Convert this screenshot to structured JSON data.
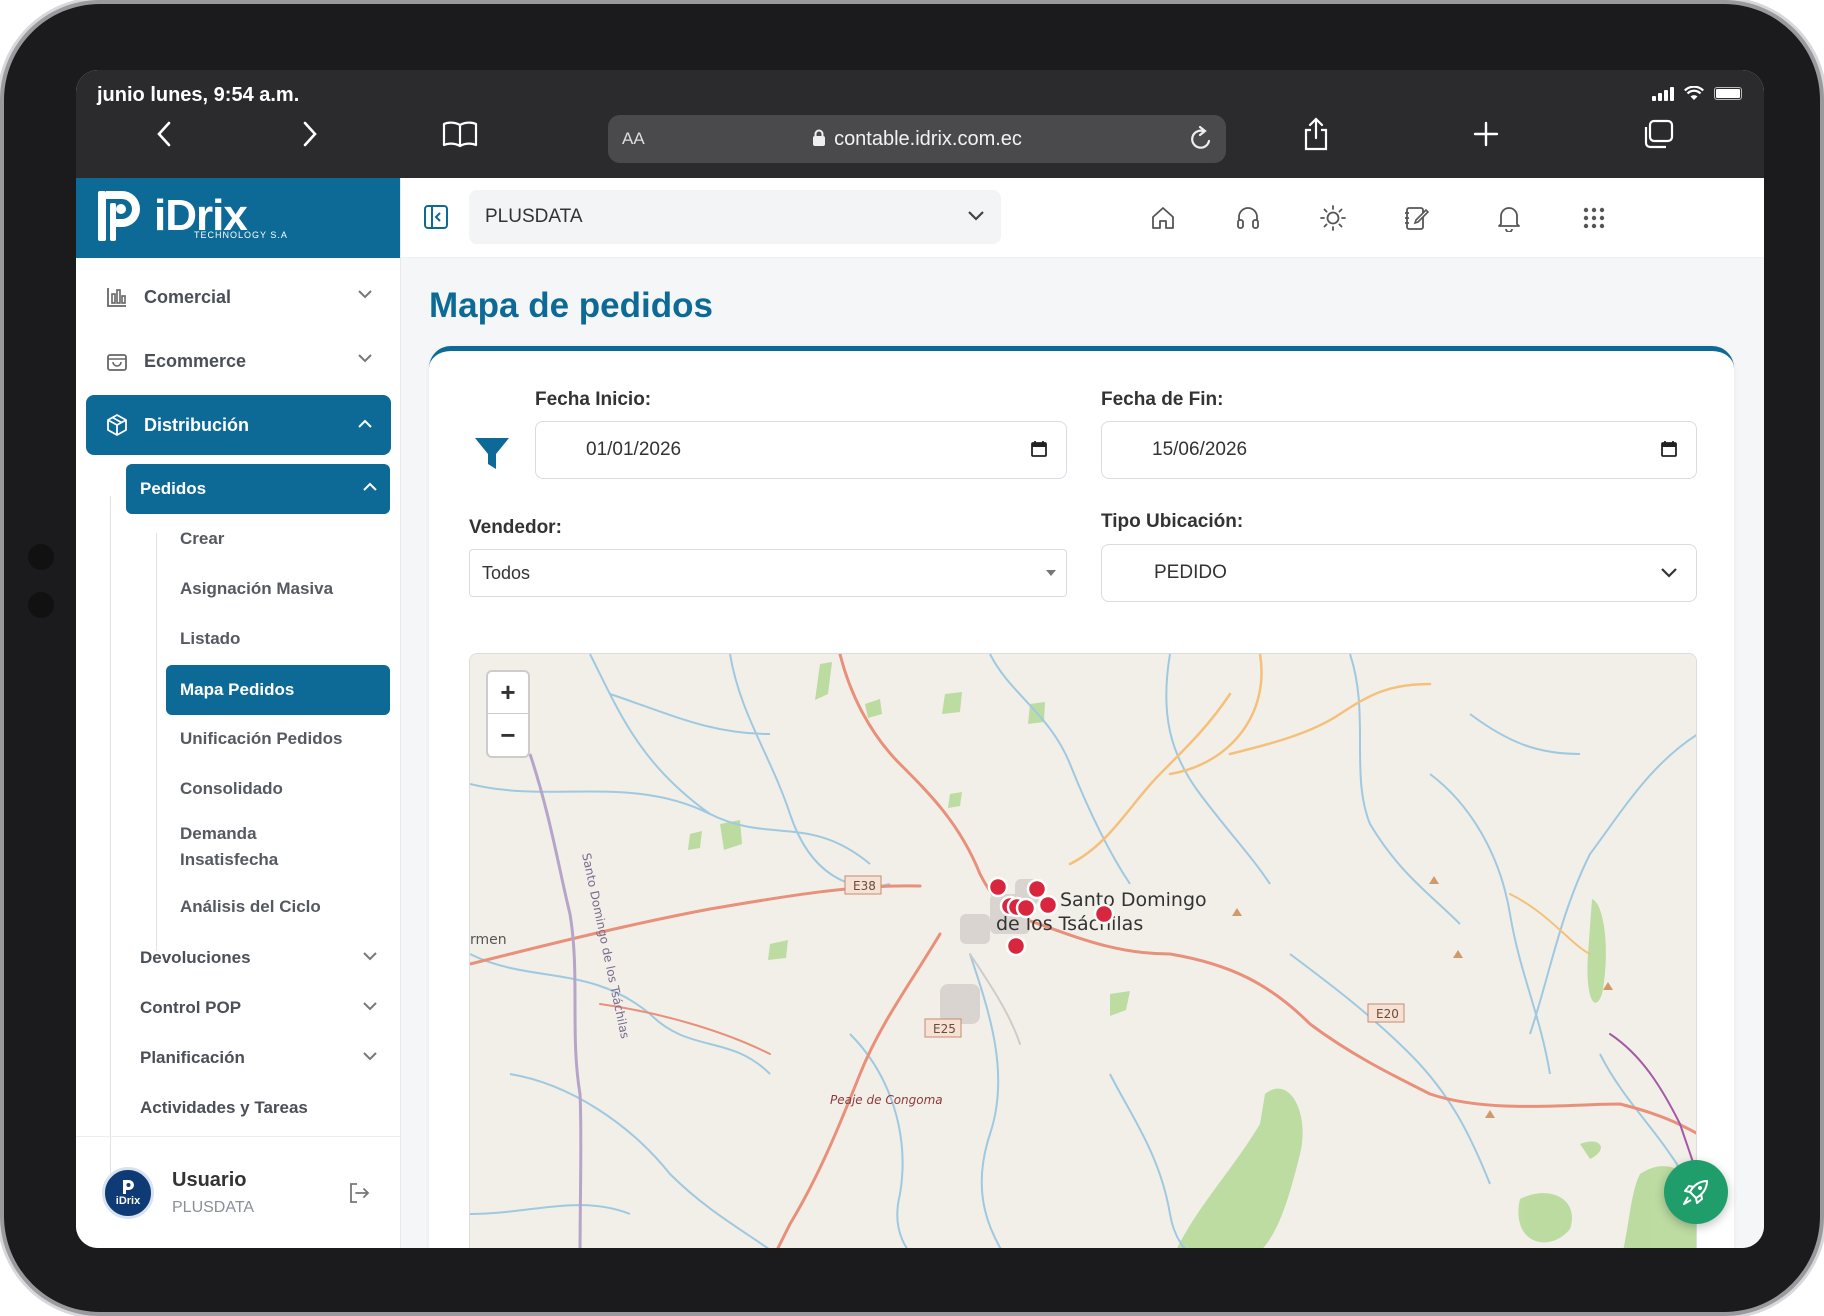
{
  "status_bar": {
    "time": "junio lunes, 9:54 a.m."
  },
  "browser": {
    "text_size_label": "AA",
    "url": "contable.idrix.com.ec"
  },
  "brand": {
    "name": "iDrix",
    "sub": "TECHNOLOGY S.A"
  },
  "sidebar": {
    "items": [
      {
        "label": "Comercial"
      },
      {
        "label": "Ecommerce"
      },
      {
        "label": "Distribución"
      }
    ],
    "pedidos": {
      "label": "Pedidos",
      "children": [
        {
          "label": "Crear"
        },
        {
          "label": "Asignación Masiva"
        },
        {
          "label": "Listado"
        },
        {
          "label": "Mapa Pedidos"
        },
        {
          "label": "Unificación Pedidos"
        },
        {
          "label": "Consolidado"
        },
        {
          "label": "Demanda Insatisfecha"
        },
        {
          "label": "Análisis del Ciclo"
        }
      ]
    },
    "sub_sections": [
      {
        "label": "Devoluciones"
      },
      {
        "label": "Control POP"
      },
      {
        "label": "Planificación"
      },
      {
        "label": "Actividades y Tareas"
      }
    ]
  },
  "user": {
    "name": "Usuario",
    "company": "PLUSDATA",
    "avatar_text": "iDrix"
  },
  "topbar": {
    "company_select": "PLUSDATA"
  },
  "page": {
    "title": "Mapa de pedidos",
    "fecha_inicio_label": "Fecha Inicio:",
    "fecha_inicio_value": "01/01/2026",
    "fecha_fin_label": "Fecha de Fin:",
    "fecha_fin_value": "15/06/2026",
    "vendedor_label": "Vendedor:",
    "vendedor_value": "Todos",
    "tipo_ubicacion_label": "Tipo Ubicación:",
    "tipo_ubicacion_value": "PEDIDO"
  },
  "map": {
    "zoom_in": "+",
    "zoom_out": "−",
    "labels": {
      "city_line1": "Santo Domingo",
      "city_line2": "de los Tsáchilas",
      "e38": "E38",
      "e25": "E25",
      "e20": "E20",
      "peaje": "Peaje de Congoma",
      "river_road": "Santo Domingo de los Tsáchilas",
      "edge_town": "rmen"
    }
  },
  "colors": {
    "brand": "#0d6a96",
    "marker": "#d7263d",
    "fab": "#1f9d6a"
  }
}
